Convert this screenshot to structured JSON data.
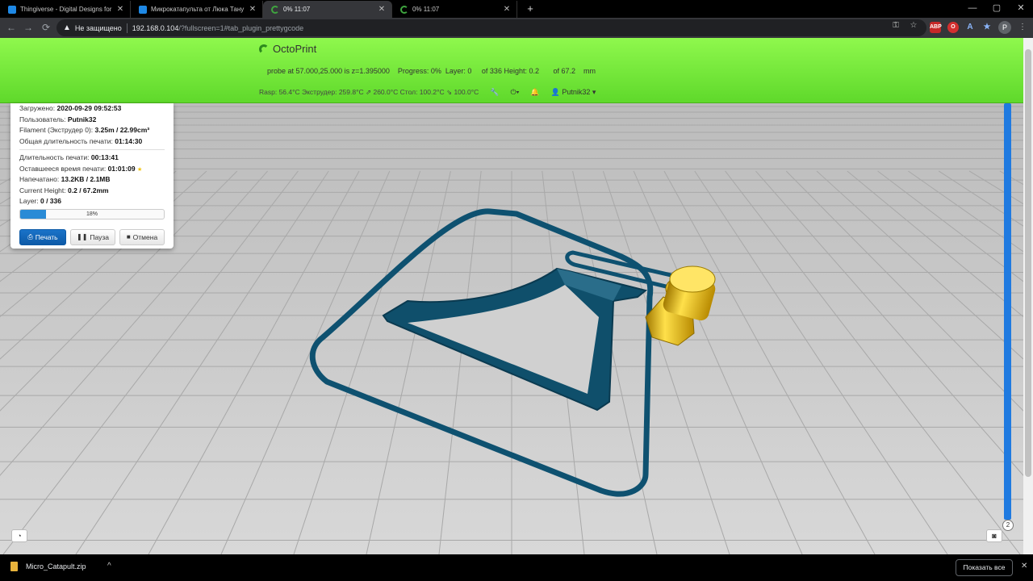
{
  "browser": {
    "tabs": [
      {
        "title": "Thingiverse - Digital Designs for",
        "favicon": "thingiverse-icon",
        "active": false
      },
      {
        "title": "Микрокатапульта от Люка Тану",
        "favicon": "thingiverse-icon",
        "active": false
      },
      {
        "title": "0% 11:07",
        "favicon": "octoprint-icon",
        "active": true
      },
      {
        "title": "0% 11:07",
        "favicon": "octoprint-icon",
        "active": false
      }
    ],
    "new_tab": "+",
    "window_controls": {
      "minimize": "—",
      "maximize": "▢",
      "close": "✕"
    },
    "nav": {
      "back": "←",
      "forward": "→",
      "reload": "⟳"
    },
    "address": {
      "security_label": "Не защищено",
      "host": "192.168.0.104",
      "path": "/?fullscreen=1#tab_plugin_prettygcode"
    },
    "extensions": [
      "ABP",
      "O",
      "A",
      "★"
    ],
    "profile_initial": "P"
  },
  "octoprint": {
    "brand": "OctoPrint",
    "info_line": "probe at 57.000,25.000 is z=1.395000    Progress: 0%  Layer: 0     of 336 Height: 0.2       of 67.2    mm",
    "status_line": "Rasp: 56.4°C Экструдер: 259.8°C ⇗ 260.0°C Стол: 100.2°C ⇘ 100.0°C",
    "user": "Putnik32",
    "accent_color": "#8ff84d"
  },
  "panel": {
    "uploaded_label": "Загружено:",
    "uploaded_value": "2020-09-29 09:52:53",
    "user_label": "Пользователь:",
    "user_value": "Putnik32",
    "filament_label": "Filament (Экструдер 0):",
    "filament_value": "3.25m / 22.99cm³",
    "total_time_label": "Общая длительность печати:",
    "total_time_value": "01:14:30",
    "print_time_label": "Длительность печати:",
    "print_time_value": "00:13:41",
    "remaining_label": "Оставшееся время печати:",
    "remaining_value": "01:01:09",
    "printed_label": "Напечатано:",
    "printed_value": "13.2KB / 2.1MB",
    "height_label": "Current Height:",
    "height_value": "0.2 / 67.2mm",
    "layer_label": "Layer:",
    "layer_value": "0 / 336",
    "progress_text": "18%",
    "progress_fraction": 0.18,
    "buttons": {
      "print": "Печать",
      "pause": "Пауза",
      "cancel": "Отмена"
    }
  },
  "viewport": {
    "layer_badge": "2",
    "bed_color": "#d0d0d0",
    "model_color": "#0e4f6a",
    "nozzle_color": "#e0b010"
  },
  "downloads": {
    "file": "Micro_Catapult.zip",
    "show_all": "Показать все",
    "close": "✕",
    "chevron": "^"
  }
}
